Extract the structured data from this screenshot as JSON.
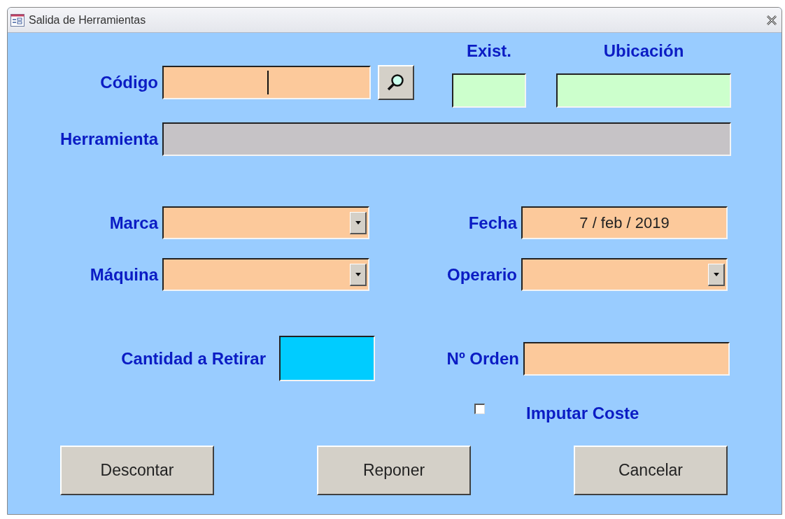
{
  "window": {
    "title": "Salida de Herramientas"
  },
  "form": {
    "codigo": {
      "label": "Código",
      "kind": "input",
      "focused": true
    },
    "existencias": {
      "label": "Exist.",
      "kind": "readonly"
    },
    "ubicacion": {
      "label": "Ubicación",
      "kind": "readonly"
    },
    "herramienta": {
      "label": "Herramienta",
      "kind": "locked"
    },
    "marca": {
      "label": "Marca",
      "kind": "combo"
    },
    "fecha": {
      "label": "Fecha",
      "kind": "input",
      "value": "7 / feb / 2019"
    },
    "maquina": {
      "label": "Máquina",
      "kind": "combo"
    },
    "operario": {
      "label": "Operario",
      "kind": "combo"
    },
    "cantidad": {
      "label": "Cantidad a Retirar",
      "kind": "quantity"
    },
    "orden": {
      "label": "Nº Orden",
      "kind": "input"
    },
    "imputar_coste": {
      "label": "Imputar Coste",
      "checked": false
    }
  },
  "buttons": [
    "Descontar",
    "Reponer",
    "Cancelar"
  ]
}
